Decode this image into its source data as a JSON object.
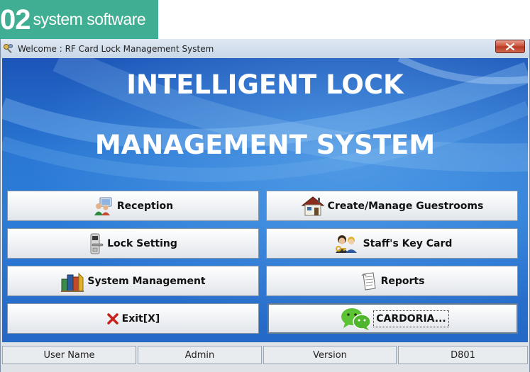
{
  "banner": {
    "number": "02",
    "text": "system software",
    "color": "#3fae92"
  },
  "window": {
    "title": "Welcome :  RF Card Lock Management System",
    "headline_line1": "INTELLIGENT LOCK",
    "headline_line2": "MANAGEMENT SYSTEM"
  },
  "buttons": {
    "reception": {
      "label": "Reception",
      "icon": "reception-icon"
    },
    "create_manage_guestrooms": {
      "label": "Create/Manage Guestrooms",
      "icon": "house-icon"
    },
    "lock_setting": {
      "label": "Lock Setting",
      "icon": "door-lock-icon"
    },
    "staff_key_card": {
      "label": "Staff's Key Card",
      "icon": "staff-key-icon"
    },
    "system_management": {
      "label": "System Management",
      "icon": "books-icon"
    },
    "reports": {
      "label": "Reports",
      "icon": "document-icon"
    },
    "exit": {
      "label": "Exit[X]",
      "icon": "red-x-icon"
    },
    "cardoria": {
      "label": "CARDORIA...",
      "icon": "wechat-icon"
    }
  },
  "statusbar": {
    "user_name_label": "User Name",
    "user_name_value": "Admin",
    "version_label": "Version",
    "version_value": "D801"
  }
}
